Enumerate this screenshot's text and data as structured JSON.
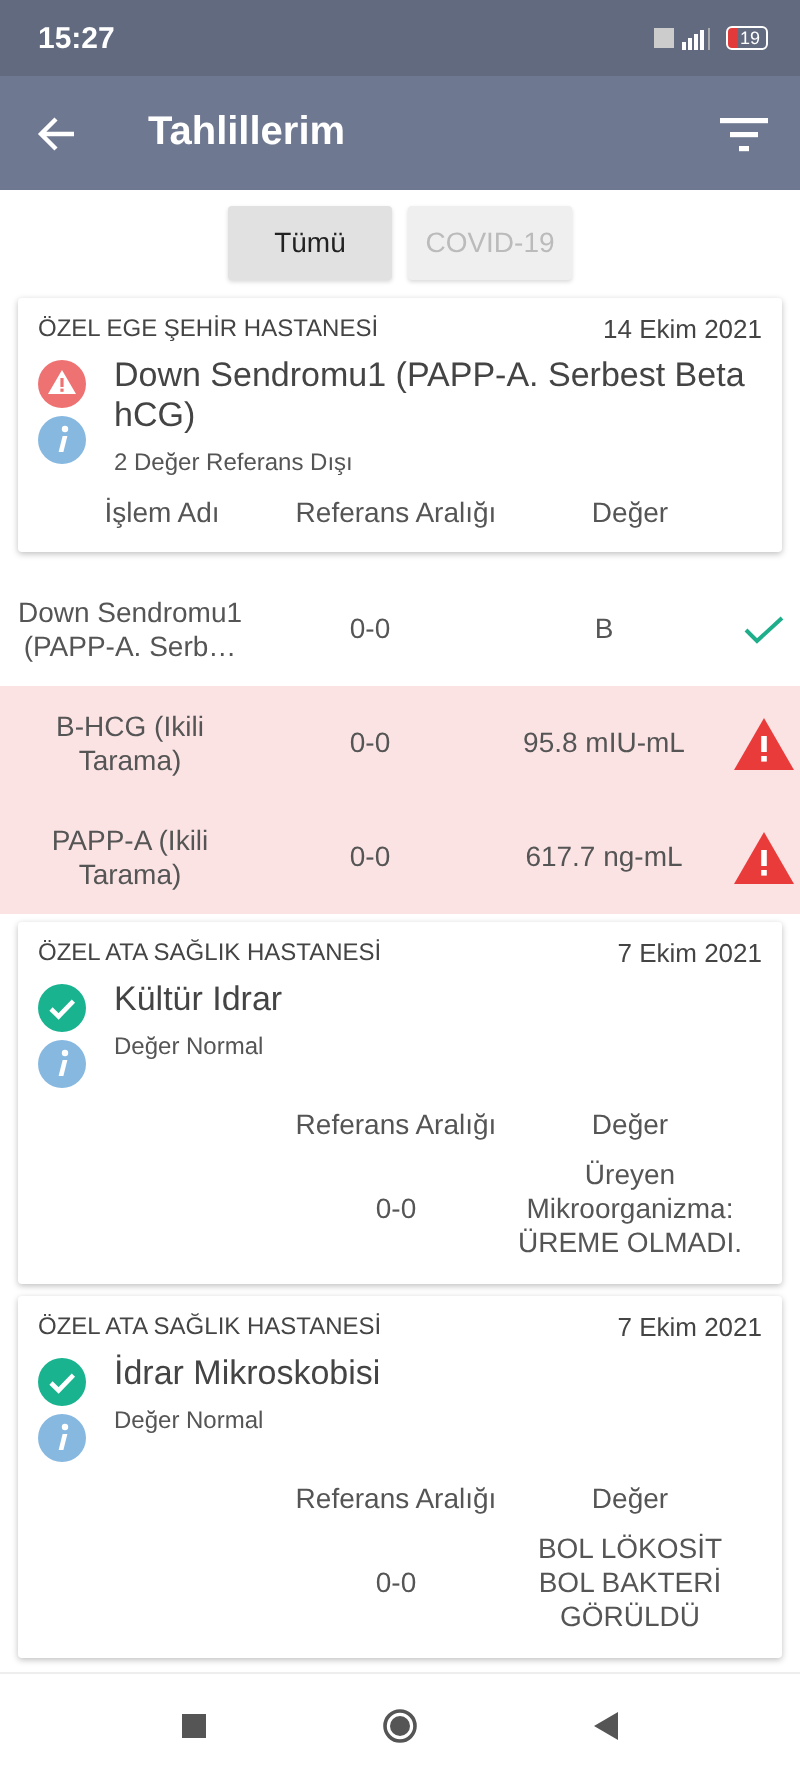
{
  "status_bar": {
    "time": "15:27",
    "battery": "19"
  },
  "app_bar": {
    "title": "Tahlillerim"
  },
  "filters": [
    {
      "label": "Tümü",
      "selected": true
    },
    {
      "label": "COVID-19",
      "selected": false
    }
  ],
  "results": [
    {
      "hospital": "ÖZEL EGE ŞEHİR HASTANESİ",
      "date": "14 Ekim 2021",
      "out_of_range": true,
      "title": "Down Sendromu1 (PAPP-A. Serbest Beta hCG)",
      "summary": "2 Değer Referans Dışı",
      "rows_detached": true,
      "columns": {
        "name": "İşlem Adı",
        "range": "Referans Aralığı",
        "value": "Değer"
      },
      "rows": [
        {
          "name": "Down Sendromu1 (PAPP-A. Serb…",
          "range": "0-0",
          "value": "B",
          "out_of_range": false
        },
        {
          "name": "B-HCG (Ikili Tarama)",
          "range": "0-0",
          "value": "95.8 mIU-mL",
          "out_of_range": true
        },
        {
          "name": "PAPP-A (Ikili Tarama)",
          "range": "0-0",
          "value": "617.7 ng-mL",
          "out_of_range": true
        }
      ]
    },
    {
      "hospital": "ÖZEL ATA SAĞLIK HASTANESİ",
      "date": "7 Ekim 2021",
      "out_of_range": false,
      "title": "Kültür Idrar",
      "summary": "Değer Normal",
      "rows_detached": false,
      "columns": {
        "range": "Referans Aralığı",
        "value": "Değer"
      },
      "rows": [
        {
          "range": "0-0",
          "value": "Üreyen Mikroorganizma: ÜREME OLMADI."
        }
      ]
    },
    {
      "hospital": "ÖZEL ATA SAĞLIK HASTANESİ",
      "date": "7 Ekim 2021",
      "out_of_range": false,
      "title": "İdrar Mikroskobisi",
      "summary": "Değer Normal",
      "rows_detached": false,
      "columns": {
        "range": "Referans Aralığı",
        "value": "Değer"
      },
      "rows": [
        {
          "range": "0-0",
          "value": "BOL LÖKOSİT BOL BAKTERİ GÖRÜLDÜ"
        }
      ]
    }
  ]
}
